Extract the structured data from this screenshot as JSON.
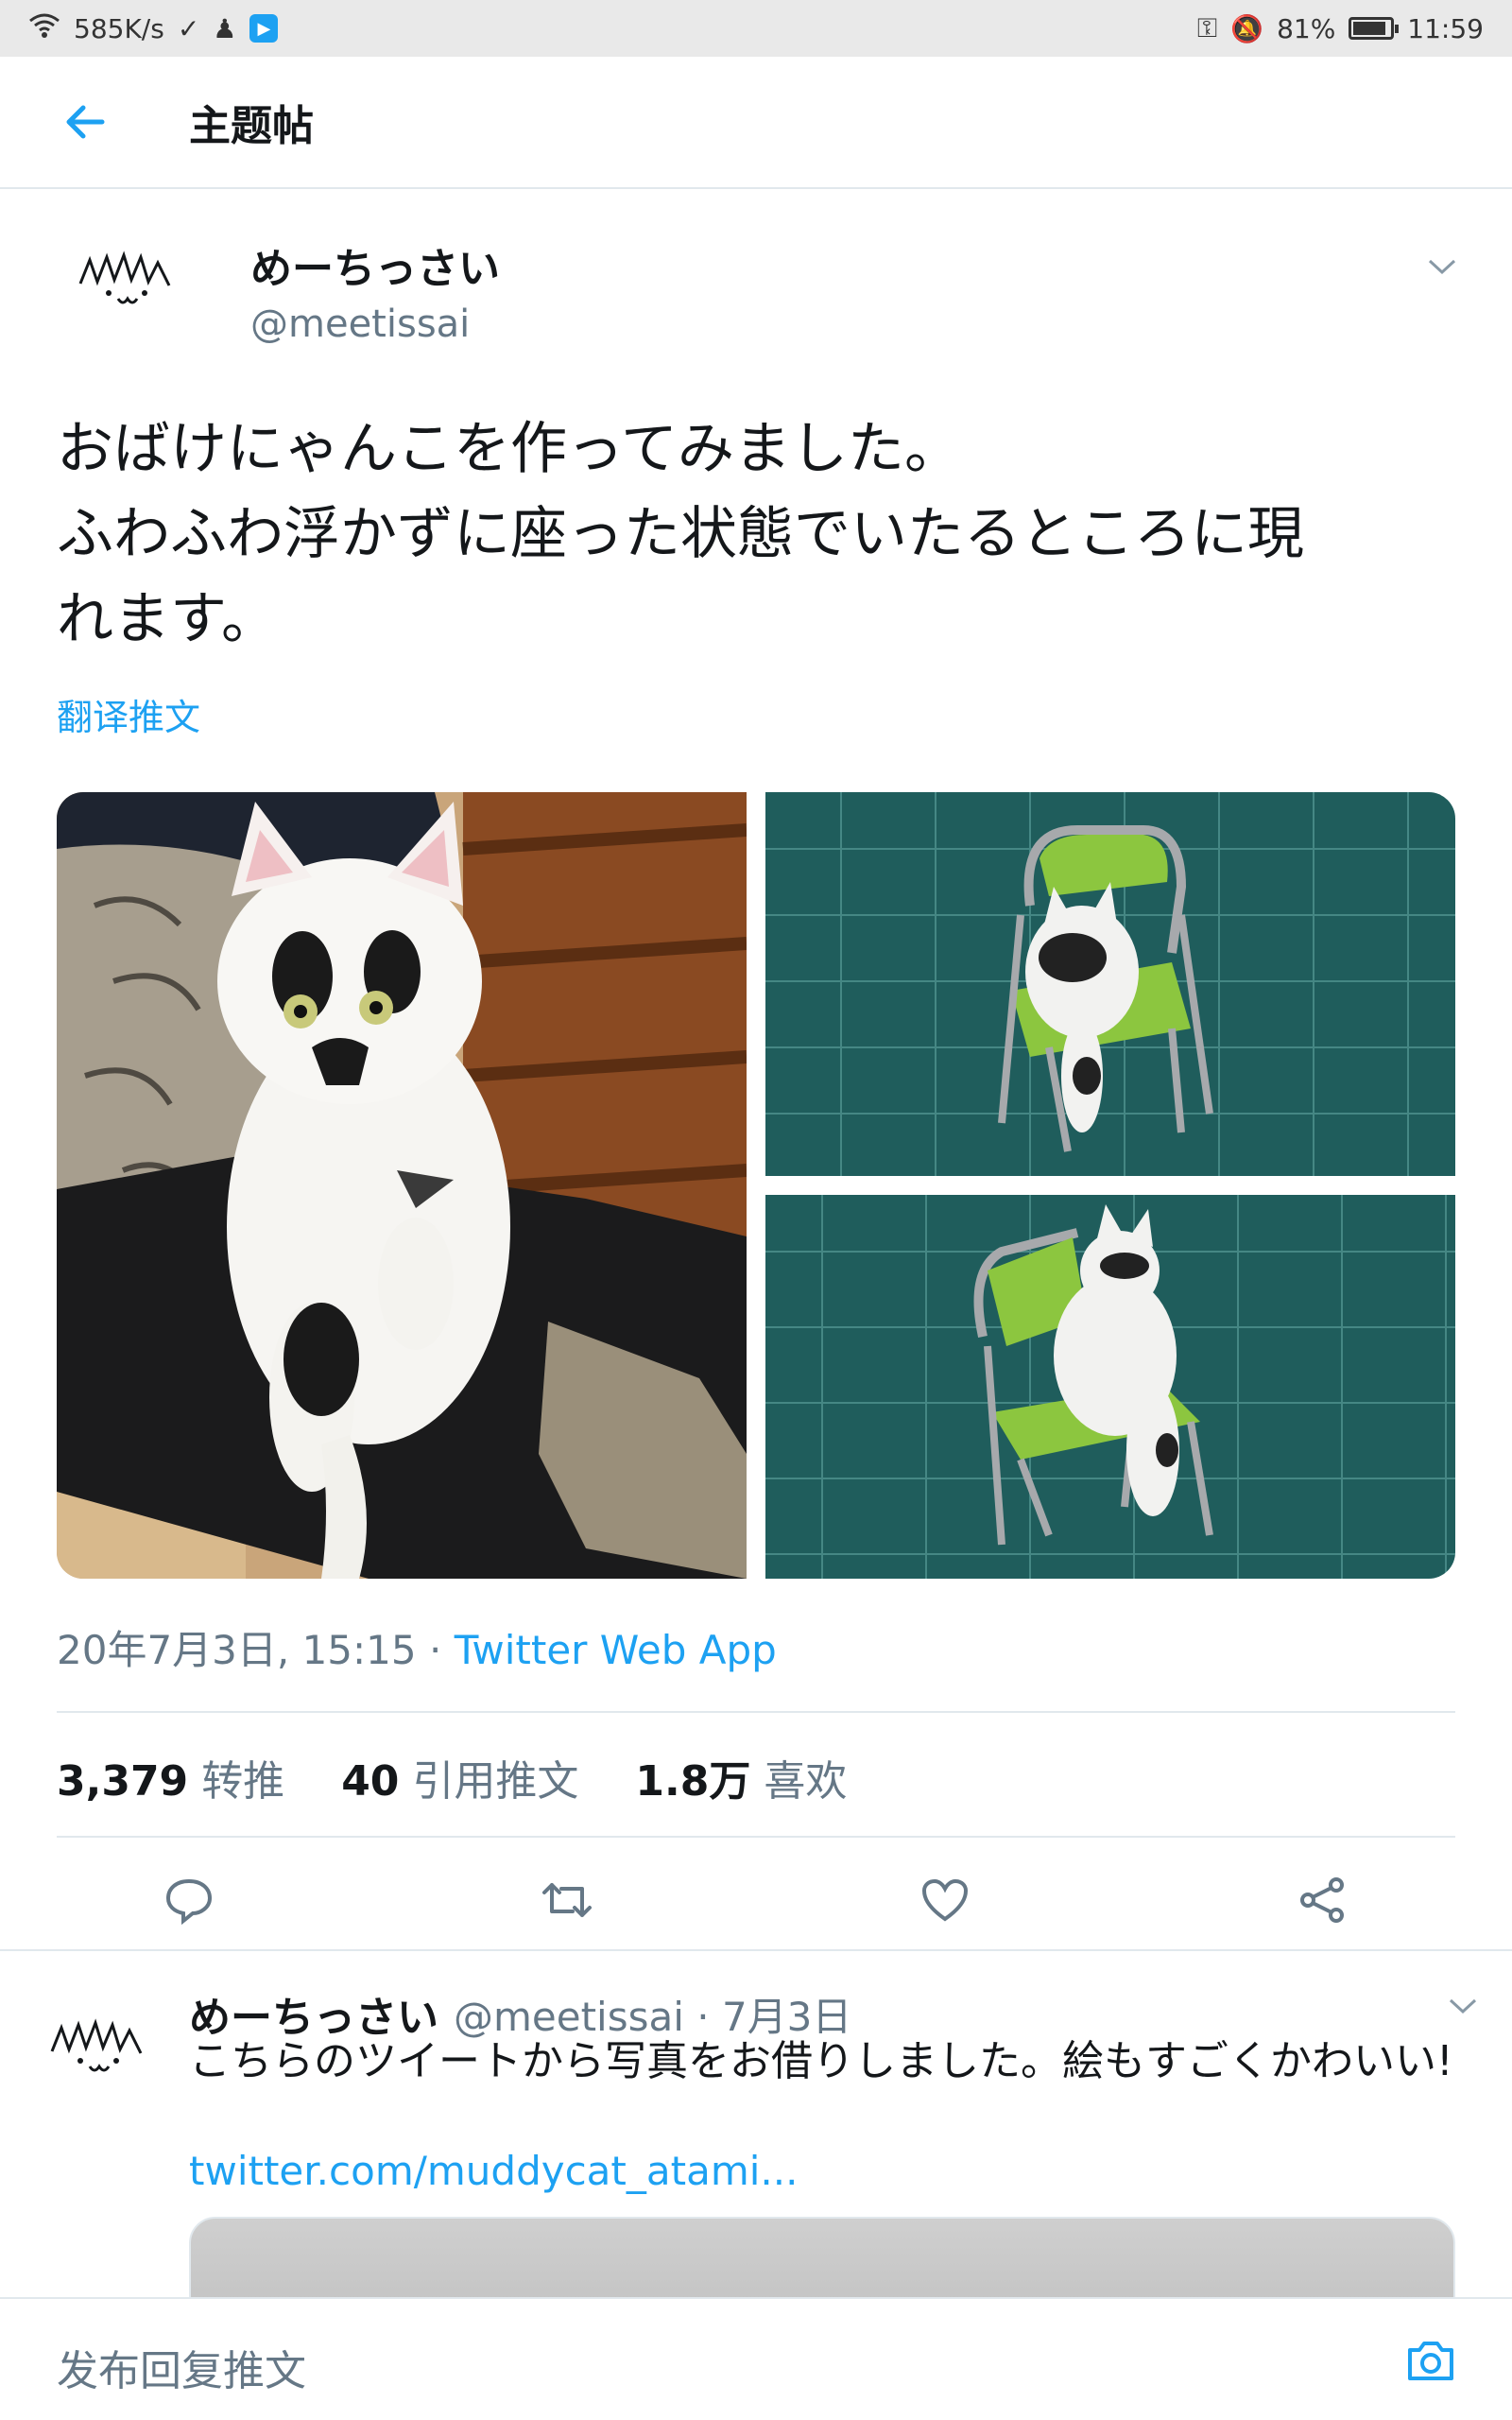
{
  "status_bar": {
    "speed": "585K/s",
    "battery": "81%",
    "battery_level": 0.81,
    "time": "11:59"
  },
  "header": {
    "title": "主题帖",
    "back_icon": "arrow-left-icon"
  },
  "tweet": {
    "author_name": "めーちっさい",
    "handle": "@meetissai",
    "text_lines": [
      "おばけにゃんこを作ってみました。",
      "ふわふわ浮かずに座った状態でいたるところに現",
      "れます。"
    ],
    "translate_label": "翻译推文",
    "date": "20年7月3日, 15:15 · ",
    "app": "Twitter Web App",
    "stats": {
      "retweets_count": "3,379",
      "retweets_label": "转推",
      "quotes_count": "40",
      "quotes_label": "引用推文",
      "likes_count": "1.8万",
      "likes_label": "喜欢"
    },
    "actions": [
      "reply-icon",
      "retweet-icon",
      "like-icon",
      "share-icon"
    ]
  },
  "reply": {
    "author_name": "めーちっさい",
    "meta": "@meetissai · 7月3日",
    "text": "こちらのツイートから写真をお借りしました。絵もすごくかわいい!",
    "link": "twitter.com/muddycat_atami..."
  },
  "compose": {
    "placeholder": "发布回复推文",
    "camera_icon": "camera-icon"
  },
  "colors": {
    "accent": "#1da1f2",
    "text": "#14171a",
    "muted": "#657786",
    "border": "#e1e8ed"
  }
}
